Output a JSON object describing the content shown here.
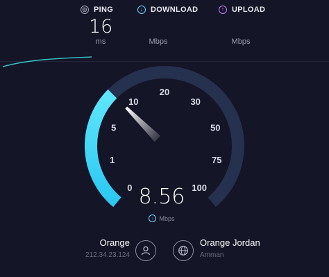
{
  "ping": {
    "label": "PING",
    "value": "16",
    "unit": "ms",
    "icon": "ping-icon"
  },
  "download": {
    "label": "DOWNLOAD",
    "value": "",
    "unit": "Mbps",
    "icon": "download-arrow-icon"
  },
  "upload": {
    "label": "UPLOAD",
    "value": "",
    "unit": "Mbps",
    "icon": "upload-arrow-icon"
  },
  "gauge": {
    "current_speed": "8.56",
    "current_value": 8.56,
    "unit": "Mbps",
    "tick_labels": [
      "0",
      "1",
      "5",
      "10",
      "20",
      "30",
      "50",
      "75",
      "100"
    ]
  },
  "isp": {
    "name": "Orange",
    "ip": "212.34.23.124"
  },
  "server": {
    "name": "Orange Jordan",
    "location": "Amman"
  },
  "colors": {
    "background": "#141526",
    "gauge_track": "#26304f",
    "gauge_fill": "#3fd3f7",
    "ping_accent": "#a8a8b8",
    "download_accent": "#6fd6ff",
    "upload_accent": "#c57cff"
  }
}
